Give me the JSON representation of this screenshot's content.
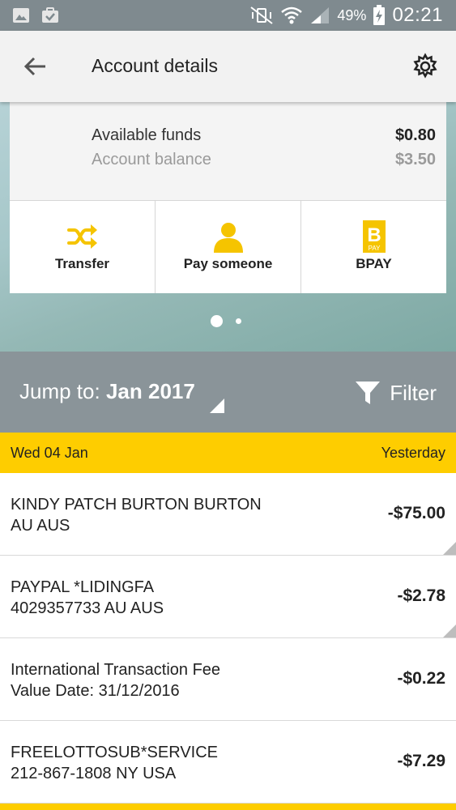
{
  "statusbar": {
    "battery_pct": "49%",
    "time": "02:21",
    "icons": [
      "gallery-icon",
      "briefcase-icon",
      "mute-vibrate-icon",
      "wifi-icon",
      "signal-icon",
      "battery-charging-icon"
    ]
  },
  "appbar": {
    "title": "Account details",
    "back_icon": "back-arrow-icon",
    "settings_icon": "gear-icon"
  },
  "funds": {
    "available_label": "Available funds",
    "available_value": "$0.80",
    "balance_label": "Account balance",
    "balance_value": "$3.50"
  },
  "actions": [
    {
      "label": "Transfer",
      "icon": "shuffle-icon"
    },
    {
      "label": "Pay someone",
      "icon": "person-icon"
    },
    {
      "label": "BPAY",
      "icon": "bpay-icon",
      "icon_text": "B",
      "icon_subtext": "PAY"
    }
  ],
  "pager": {
    "pages": 2,
    "current": 1
  },
  "jump": {
    "label": "Jump to:",
    "value": "Jan 2017",
    "filter_label": "Filter"
  },
  "date_header": {
    "date": "Wed 04 Jan",
    "relative": "Yesterday"
  },
  "transactions": [
    {
      "line1": "KINDY PATCH BURTON BURTON",
      "line2": "AU AUS",
      "amount": "-$75.00"
    },
    {
      "line1": "PAYPAL *LIDINGFA",
      "line2": "4029357733 AU AUS",
      "amount": "-$2.78"
    },
    {
      "line1": "International Transaction Fee",
      "line2": "Value Date: 31/12/2016",
      "amount": "-$0.22"
    },
    {
      "line1": "FREELOTTOSUB*SERVICE",
      "line2": "212-867-1808 NY USA",
      "amount": "-$7.29"
    }
  ],
  "colors": {
    "accent_yellow": "#fecd00",
    "statusbar": "#7f8a8f",
    "jumpbar": "#8a9499",
    "appbar": "#f2f2f2"
  }
}
